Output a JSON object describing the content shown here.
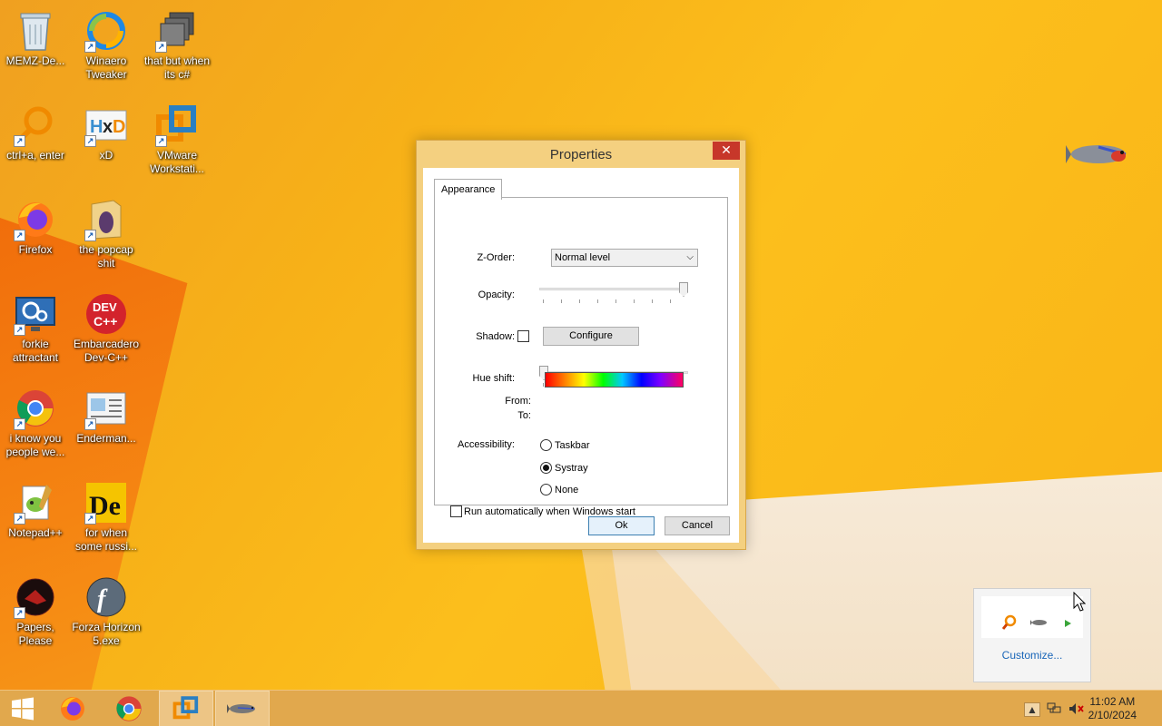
{
  "desktop": {
    "icons": [
      {
        "label": "MEMZ-De..."
      },
      {
        "label": "Winaero Tweaker"
      },
      {
        "label": "that but when its c#"
      },
      {
        "label": "ctrl+a, enter"
      },
      {
        "label": "xD"
      },
      {
        "label": "VMware Workstati..."
      },
      {
        "label": "Firefox"
      },
      {
        "label": "the popcap shit"
      },
      {
        "label": "forkie attractant"
      },
      {
        "label": "Embarcadero Dev-C++"
      },
      {
        "label": "i know you people we..."
      },
      {
        "label": "Enderman..."
      },
      {
        "label": "Notepad++"
      },
      {
        "label": "for when some russi..."
      },
      {
        "label": "Papers, Please"
      },
      {
        "label": "Forza Horizon 5.exe"
      }
    ]
  },
  "dialog": {
    "title": "Properties",
    "close_label": "✕",
    "tab_label": "Appearance",
    "zorder_label": "Z-Order:",
    "zorder_value": "Normal level",
    "opacity_label": "Opacity:",
    "opacity_value_fraction": 1.0,
    "shadow_label": "Shadow:",
    "shadow_checked": false,
    "configure_label": "Configure",
    "hue_label": "Hue shift:",
    "hue_value_fraction": 0.0,
    "from_label": "From:",
    "to_label": "To:",
    "accessibility_label": "Accessibility:",
    "radio_taskbar": "Taskbar",
    "radio_systray": "Systray",
    "radio_none": "None",
    "selected_radio": "Systray",
    "autorun_label": "Run automatically when Windows start",
    "autorun_checked": false,
    "ok_label": "Ok",
    "cancel_label": "Cancel"
  },
  "tray_popup": {
    "customize_label": "Customize..."
  },
  "taskbar": {
    "time": "11:02 AM",
    "date": "2/10/2024"
  },
  "colors": {
    "wallpaper_primary": "#fcbf1c",
    "dialog_frame": "#f4d080",
    "close_button": "#c7372a",
    "taskbar": "#e1a84d"
  }
}
